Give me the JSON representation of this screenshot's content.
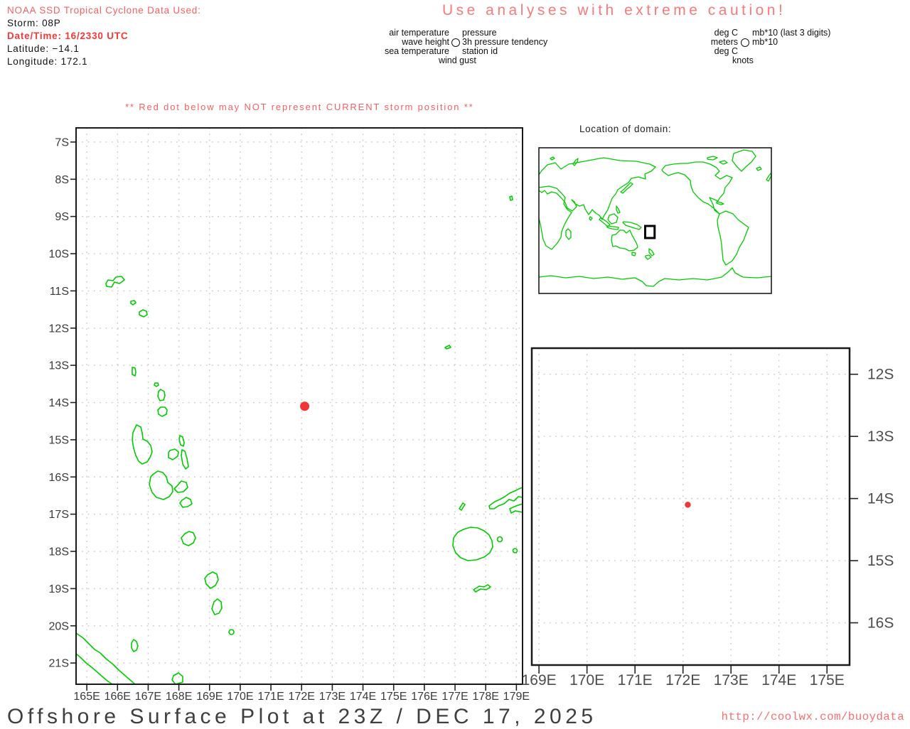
{
  "header": {
    "source": "NOAA SSD Tropical Cyclone Data Used:",
    "storm": "Storm: 08P",
    "datetime": "Date/Time: 16/2330 UTC",
    "latitude": "Latitude: −14.1",
    "longitude": "Longitude: 172.1"
  },
  "caution_banner": "Use analyses with extreme caution!",
  "storm_warning": "** Red dot below may NOT represent CURRENT storm position **",
  "station_legend": {
    "row1_left": "air temperature",
    "row1_right": "pressure",
    "row2_left": "wave height",
    "row2_right": "3h pressure tendency",
    "row3_left": "sea temperature",
    "row3_right": "station id",
    "row4": "wind gust"
  },
  "units_legend": {
    "row1_left": "deg C",
    "row1_right": "mb*10 (last 3 digits)",
    "row2_left": "meters",
    "row2_right": "mb*10",
    "row3_left": "deg C",
    "row4": "knots"
  },
  "inset_title": "Location of domain:",
  "footer": {
    "title": "Offshore Surface Plot at 23Z / DEC 17, 2025",
    "url": "http://coolwx.com/buoydata"
  },
  "colors": {
    "coastline_green": "#00CC00",
    "storm_red": "#F23535",
    "warning_red": "#F85F5F",
    "caution_red": "#F97A7A",
    "grid_gray": "#C9C9C9"
  },
  "chart_data": [
    {
      "id": "main-map",
      "type": "scatter",
      "description": "Offshore surface plot map, Vanuatu/Fiji region, storm position dot",
      "xlim": [
        164.65,
        179.2
      ],
      "ylim": [
        -21.57,
        -6.62
      ],
      "grid": "dotted 1-degree",
      "x_ticks": {
        "values": [
          165,
          166,
          167,
          168,
          169,
          170,
          171,
          172,
          173,
          174,
          175,
          176,
          177,
          178,
          179
        ],
        "labels": [
          "165E",
          "166E",
          "167E",
          "168E",
          "169E",
          "170E",
          "171E",
          "172E",
          "173E",
          "174E",
          "175E",
          "176E",
          "177E",
          "178E",
          "179E"
        ]
      },
      "y_ticks": {
        "values": [
          -7,
          -8,
          -9,
          -10,
          -11,
          -12,
          -13,
          -14,
          -15,
          -16,
          -17,
          -18,
          -19,
          -20,
          -21
        ],
        "labels": [
          "7S",
          "8S",
          "9S",
          "10S",
          "11S",
          "12S",
          "13S",
          "14S",
          "15S",
          "16S",
          "17S",
          "18S",
          "19S",
          "20S",
          "21S"
        ]
      },
      "points": [
        {
          "name": "storm-position-dot",
          "lon": 172.1,
          "lat": -14.1,
          "radius": 6.5,
          "color": "#F23535"
        }
      ]
    },
    {
      "id": "zoom-map",
      "type": "scatter",
      "description": "Zoomed domain map around storm position",
      "xlim": [
        168.85,
        175.47
      ],
      "ylim": [
        -16.68,
        -11.58
      ],
      "grid": "dotted 1-degree",
      "x_ticks": {
        "values": [
          169,
          170,
          171,
          172,
          173,
          174,
          175
        ],
        "labels": [
          "169E",
          "170E",
          "171E",
          "172E",
          "173E",
          "174E",
          "175E"
        ]
      },
      "y_ticks": {
        "values": [
          -12,
          -13,
          -14,
          -15,
          -16
        ],
        "labels": [
          "12S",
          "13S",
          "14S",
          "15S",
          "16S"
        ]
      },
      "points": [
        {
          "name": "storm-position-dot-zoom",
          "lon": 172.1,
          "lat": -14.1,
          "radius": 4.2,
          "color": "#F23535"
        }
      ]
    },
    {
      "id": "world-inset",
      "type": "map",
      "title": "Location of domain:",
      "lon_range": [
        0,
        360
      ],
      "lat_range": [
        -90,
        90
      ],
      "domain_box": {
        "lon": [
          164.6,
          179.2
        ],
        "lat": [
          -21.5,
          -6.6
        ]
      }
    }
  ]
}
